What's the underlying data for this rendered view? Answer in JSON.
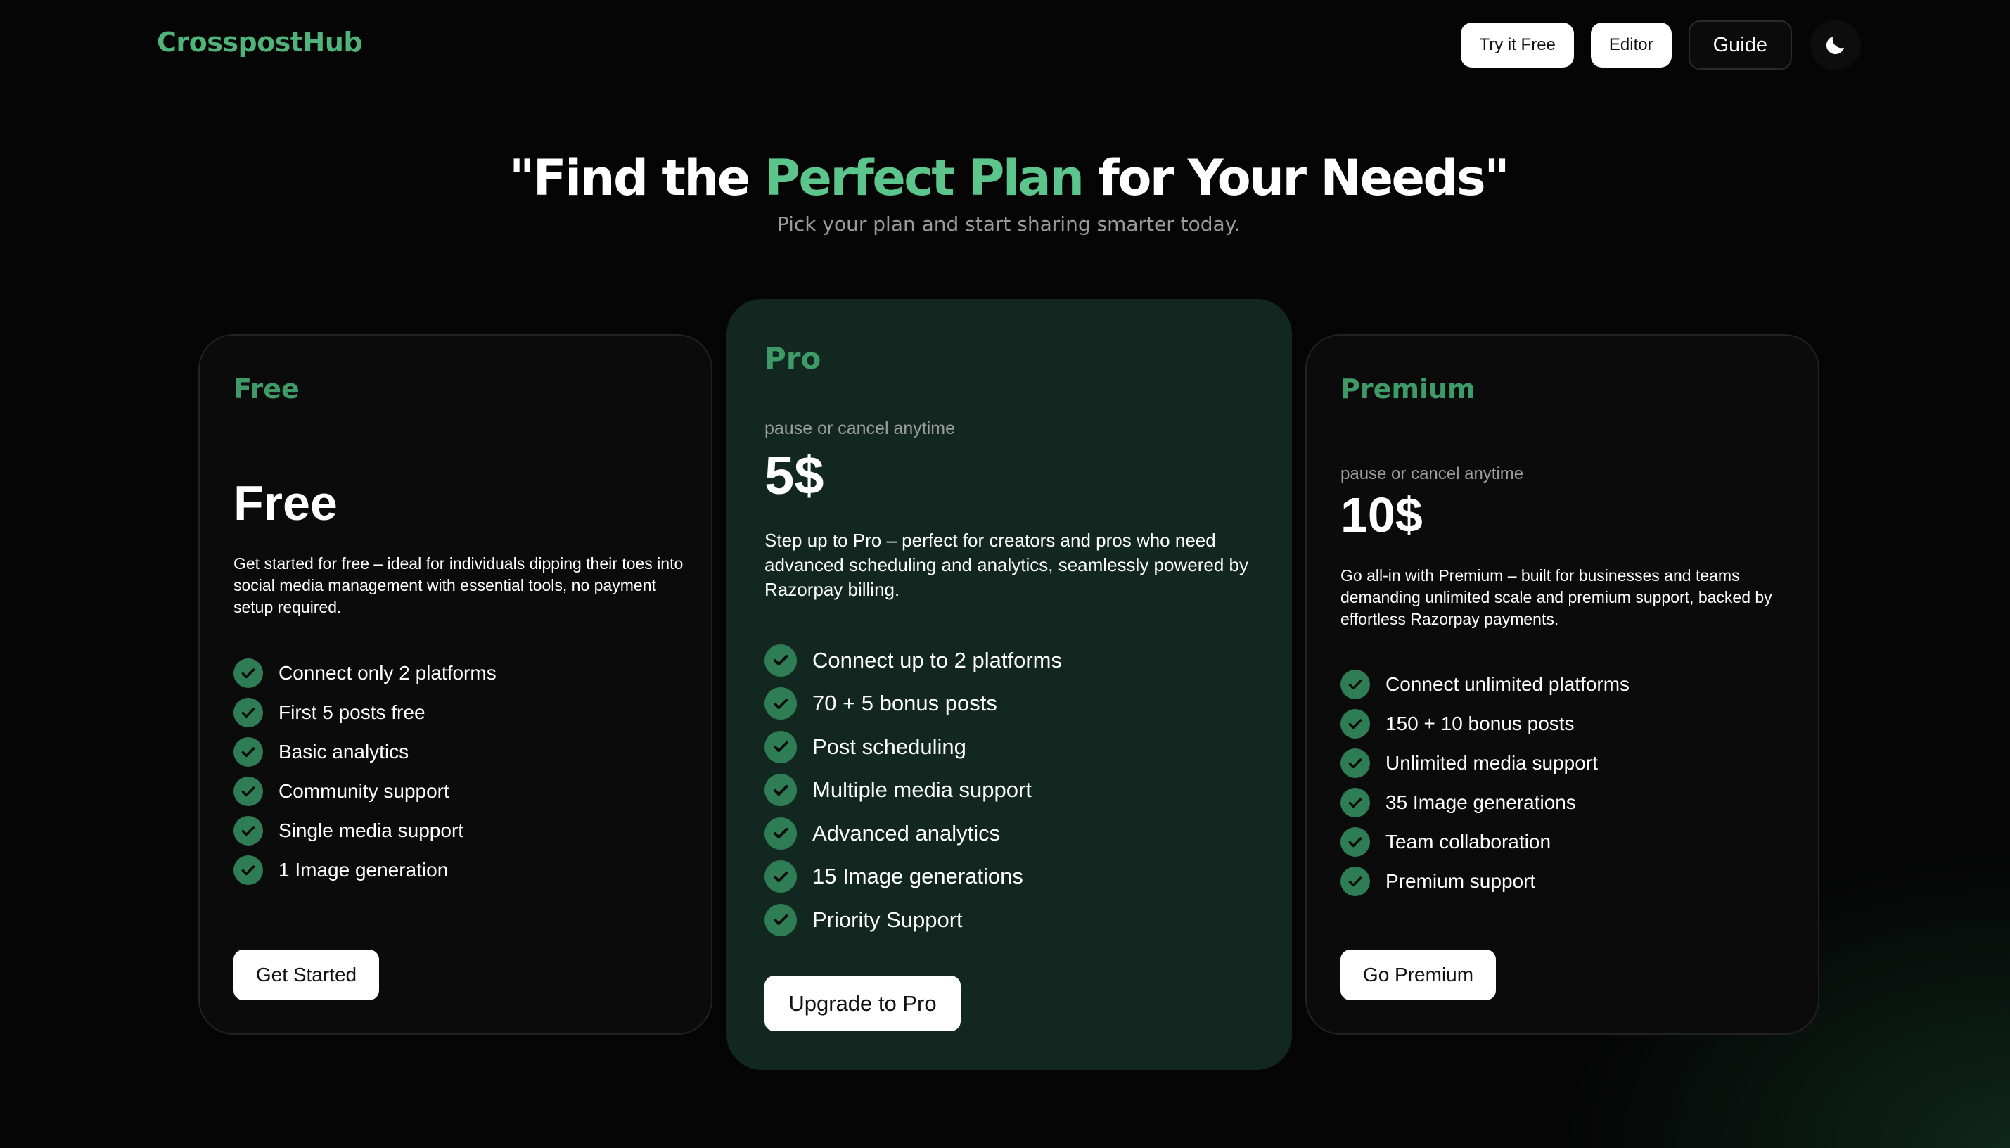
{
  "brand": "CrosspostHub",
  "nav": {
    "try_free": "Try it Free",
    "editor": "Editor",
    "guide": "Guide",
    "theme_icon": "moon-icon"
  },
  "hero": {
    "title_prefix": "\"Find the ",
    "title_accent": "Perfect Plan",
    "title_suffix": " for Your Needs\"",
    "subtitle": "Pick your plan and start sharing smarter today."
  },
  "colors": {
    "accent": "#5cc58c",
    "plan_name": "#3e9b68",
    "check": "#2f7d55",
    "pro_card_bg": "#112720"
  },
  "plans": {
    "free": {
      "name": "Free",
      "price": "Free",
      "description": "Get started for free – ideal for individuals dipping their toes into social media management with essential tools, no payment setup required.",
      "features": [
        "Connect only 2 platforms",
        "First 5 posts free",
        "Basic analytics",
        "Community support",
        "Single media support",
        "1 Image generation"
      ],
      "cta": "Get Started"
    },
    "pro": {
      "name": "Pro",
      "note": "pause or cancel anytime",
      "price": "5$",
      "description": "Step up to Pro – perfect for creators and pros who need advanced scheduling and analytics, seamlessly powered by Razorpay billing.",
      "features": [
        "Connect up to 2 platforms",
        "70 + 5 bonus posts",
        "Post scheduling",
        "Multiple media support",
        "Advanced analytics",
        "15 Image generations",
        "Priority Support"
      ],
      "cta": "Upgrade to Pro"
    },
    "premium": {
      "name": "Premium",
      "note": "pause or cancel anytime",
      "price": "10$",
      "description": "Go all-in with Premium – built for businesses and teams demanding unlimited scale and premium support, backed by effortless Razorpay payments.",
      "features": [
        "Connect unlimited platforms",
        "150 + 10 bonus posts",
        "Unlimited media support",
        "35 Image generations",
        "Team collaboration",
        "Premium support"
      ],
      "cta": "Go Premium"
    }
  }
}
